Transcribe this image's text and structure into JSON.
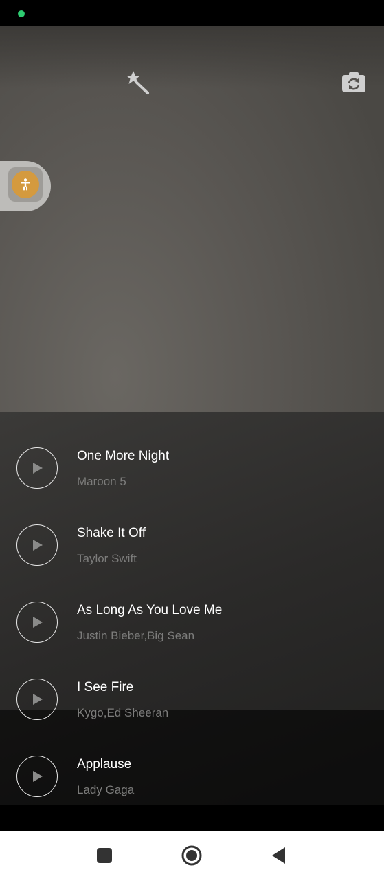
{
  "icons": {
    "status_dot": "status-dot-icon",
    "magic_wand": "magic-wand-icon",
    "flip_camera": "flip-camera-icon",
    "accessibility": "accessibility-icon",
    "play": "play-icon",
    "nav_recents": "recents-icon",
    "nav_home": "home-icon",
    "nav_back": "back-icon"
  },
  "colors": {
    "status_dot": "#2ecc71",
    "accessibility_accent": "#d49a3f",
    "title_text": "#ffffff",
    "artist_text": "#7c7c7b"
  },
  "songs": [
    {
      "title": "One More Night",
      "artist": "Maroon 5"
    },
    {
      "title": "Shake It Off",
      "artist": "Taylor Swift"
    },
    {
      "title": "As Long As You Love Me",
      "artist": "Justin Bieber,Big Sean"
    },
    {
      "title": "I See Fire",
      "artist": "Kygo,Ed Sheeran"
    },
    {
      "title": "Applause",
      "artist": "Lady Gaga"
    }
  ]
}
